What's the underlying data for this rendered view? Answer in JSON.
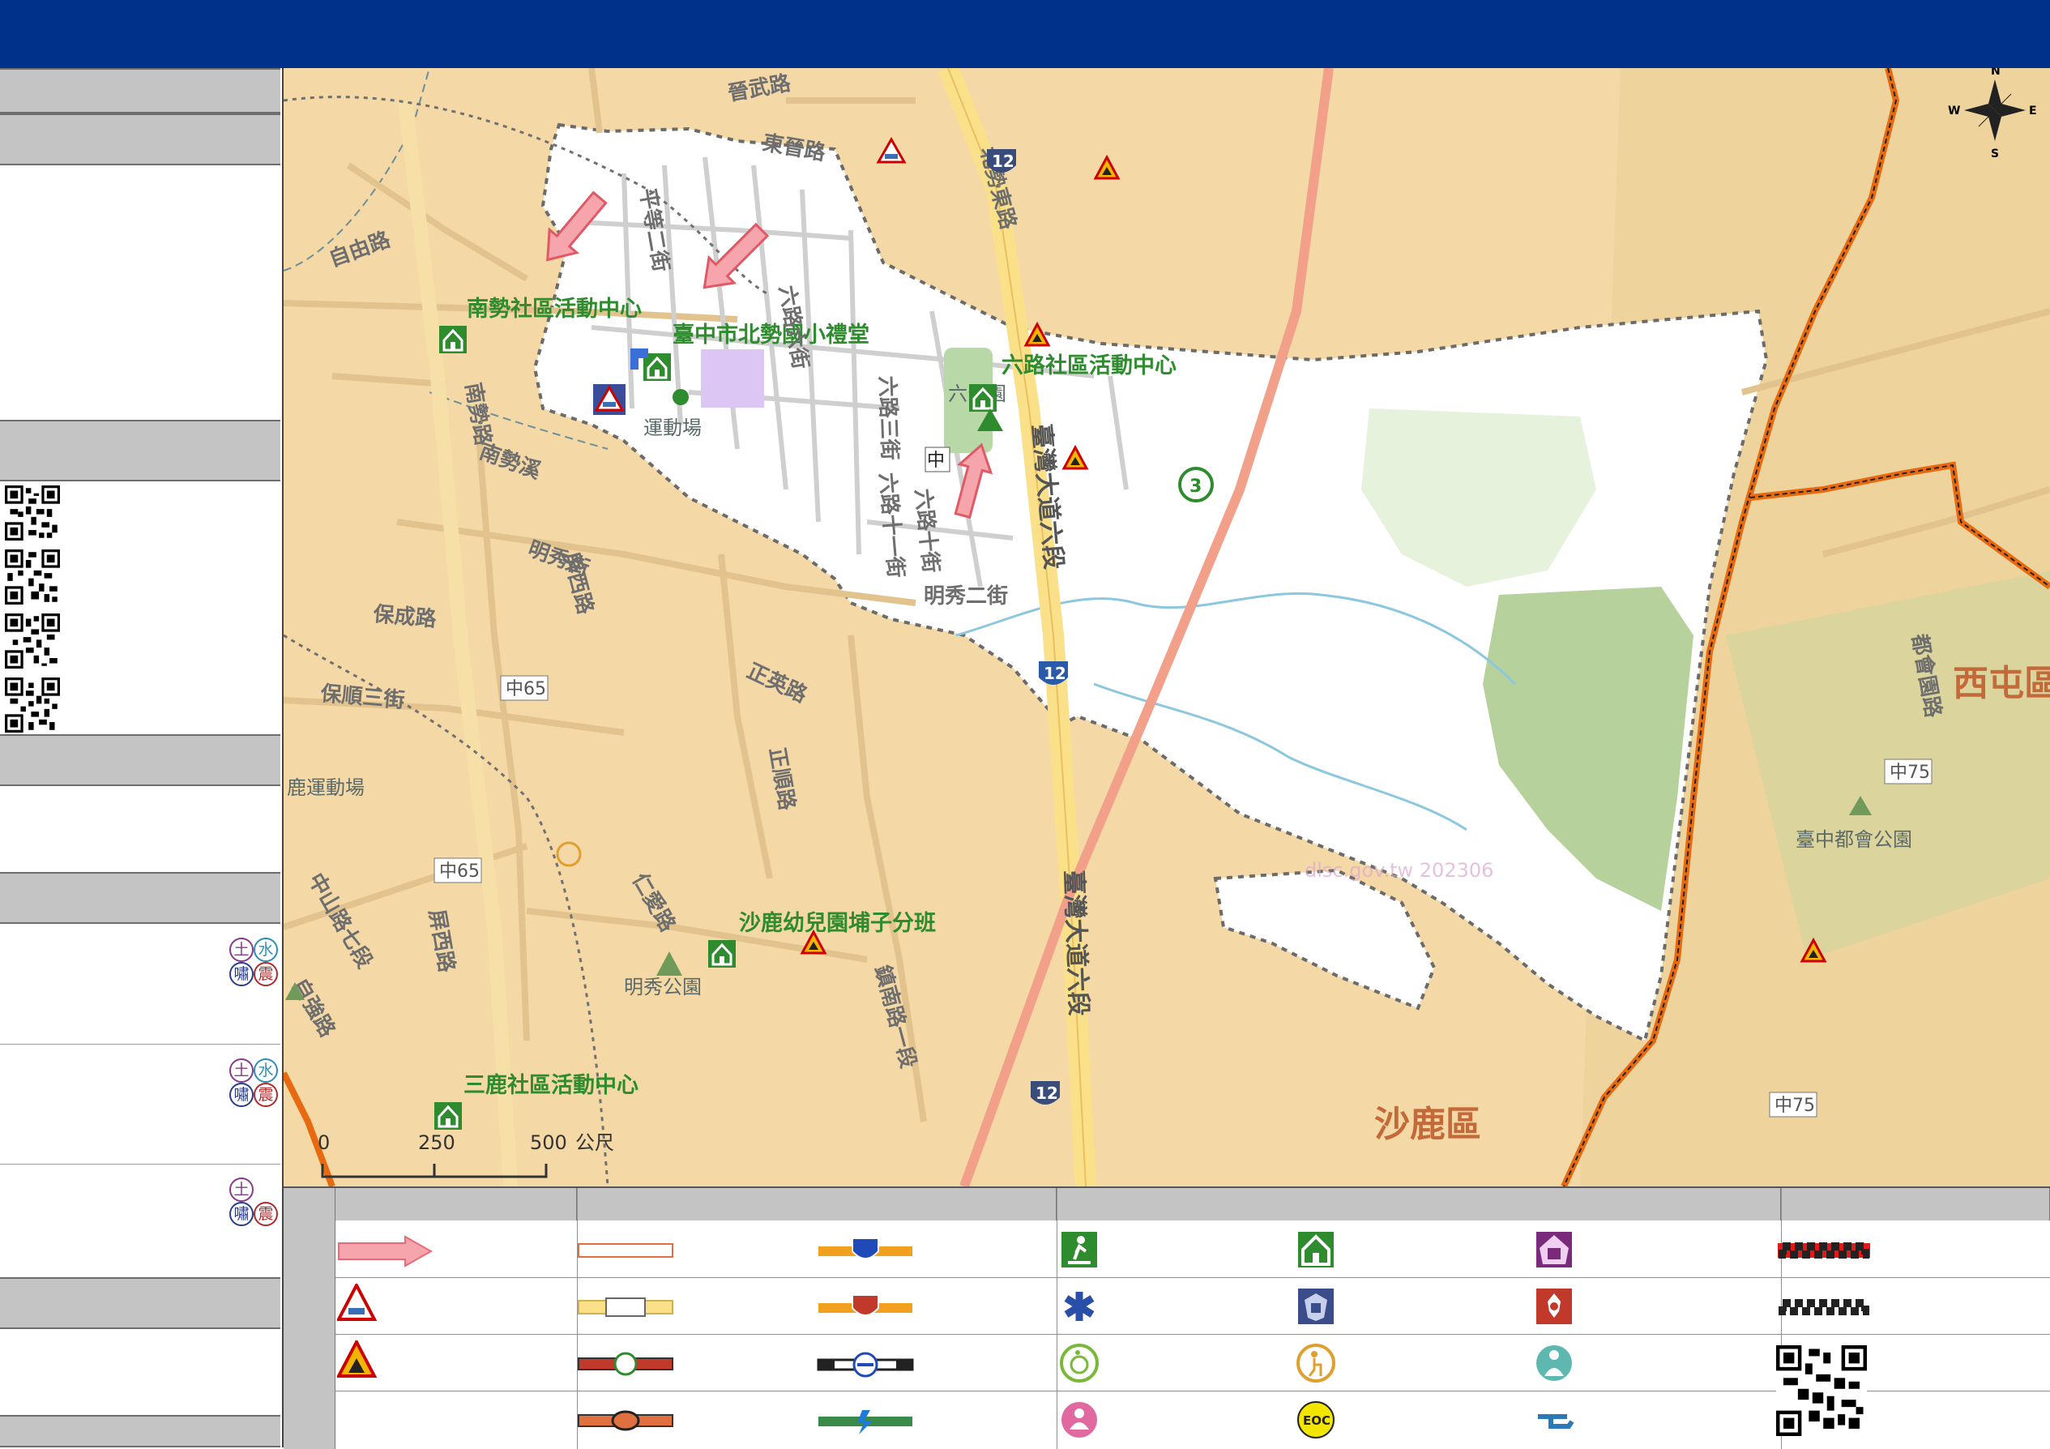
{
  "map": {
    "place_labels": [
      {
        "id": "nanshi",
        "text": "南勢社區活動中心"
      },
      {
        "id": "beishi",
        "text": "臺中市北勢國小禮堂"
      },
      {
        "id": "liulu",
        "text": "六路社區活動中心"
      },
      {
        "id": "shalu-kinder",
        "text": "沙鹿幼兒園埔子分班"
      },
      {
        "id": "sanlu",
        "text": "三鹿社區活動中心"
      },
      {
        "id": "shalu-district",
        "text": "沙鹿區"
      },
      {
        "id": "xitun",
        "text": "西屯區"
      },
      {
        "id": "stadium",
        "text": "運動場"
      },
      {
        "id": "luyun",
        "text": "鹿運動場"
      },
      {
        "id": "mingxiu-park",
        "text": "明秀公園"
      },
      {
        "id": "dudu-park",
        "text": "臺中都會公園"
      },
      {
        "id": "liu-park",
        "text": "六公園"
      }
    ],
    "road_labels": [
      {
        "id": "r1",
        "text": "平等二街"
      },
      {
        "id": "r2",
        "text": "六路六街"
      },
      {
        "id": "r3",
        "text": "六路三街"
      },
      {
        "id": "r4",
        "text": "六路十一街"
      },
      {
        "id": "r5",
        "text": "六路十街"
      },
      {
        "id": "r6",
        "text": "明秀二街"
      },
      {
        "id": "r7",
        "text": "臺灣大道六段"
      },
      {
        "id": "r8",
        "text": "臺灣大道六段"
      },
      {
        "id": "r9",
        "text": "北勢東路"
      },
      {
        "id": "r10",
        "text": "自由路"
      },
      {
        "id": "r11",
        "text": "南勢溪"
      },
      {
        "id": "r12",
        "text": "屏西路"
      },
      {
        "id": "r13",
        "text": "屏西路"
      },
      {
        "id": "r14",
        "text": "保成路"
      },
      {
        "id": "r15",
        "text": "保順三街"
      },
      {
        "id": "r16",
        "text": "正英路"
      },
      {
        "id": "r17",
        "text": "正順路"
      },
      {
        "id": "r18",
        "text": "鎮南路一段"
      },
      {
        "id": "r19",
        "text": "都會園路"
      },
      {
        "id": "r20",
        "text": "中65"
      },
      {
        "id": "r21",
        "text": "中65"
      },
      {
        "id": "r22",
        "text": "中75"
      },
      {
        "id": "r23",
        "text": "中75"
      },
      {
        "id": "r24",
        "text": "晉武路"
      },
      {
        "id": "r25",
        "text": "東晉路"
      },
      {
        "id": "r26",
        "text": "自強路"
      },
      {
        "id": "r27",
        "text": "中山路七段"
      },
      {
        "id": "r28",
        "text": "明秀街"
      },
      {
        "id": "r29",
        "text": "南勢路"
      },
      {
        "id": "r30",
        "text": "仁愛路"
      }
    ],
    "route_shields": [
      {
        "id": "s12a",
        "text": "12"
      },
      {
        "id": "s12b",
        "text": "12"
      },
      {
        "id": "s12c",
        "text": "12"
      },
      {
        "id": "s3",
        "text": "3"
      }
    ],
    "zhong_marker": "中",
    "scale": {
      "ticks": [
        "0",
        "250",
        "500"
      ],
      "unit": "公尺"
    },
    "watermark": "dlsc.gov.tw 202306",
    "compass": {
      "n": "N",
      "s": "S",
      "e": "E",
      "w": "W"
    }
  },
  "sidebar": {
    "hazard_badges": {
      "soil": "土",
      "water": "水",
      "sea": "嘯",
      "quake": "震"
    }
  },
  "legend": {
    "eoc_label": "EOC"
  },
  "colors": {
    "top_bar": "#00318a",
    "panel_header": "#c4c4c4",
    "map_land": "#f4d8a6",
    "shelter_green": "#2e8b2e",
    "boundary_orange": "#e86a10",
    "evac_arrow": "#ee6e78"
  }
}
